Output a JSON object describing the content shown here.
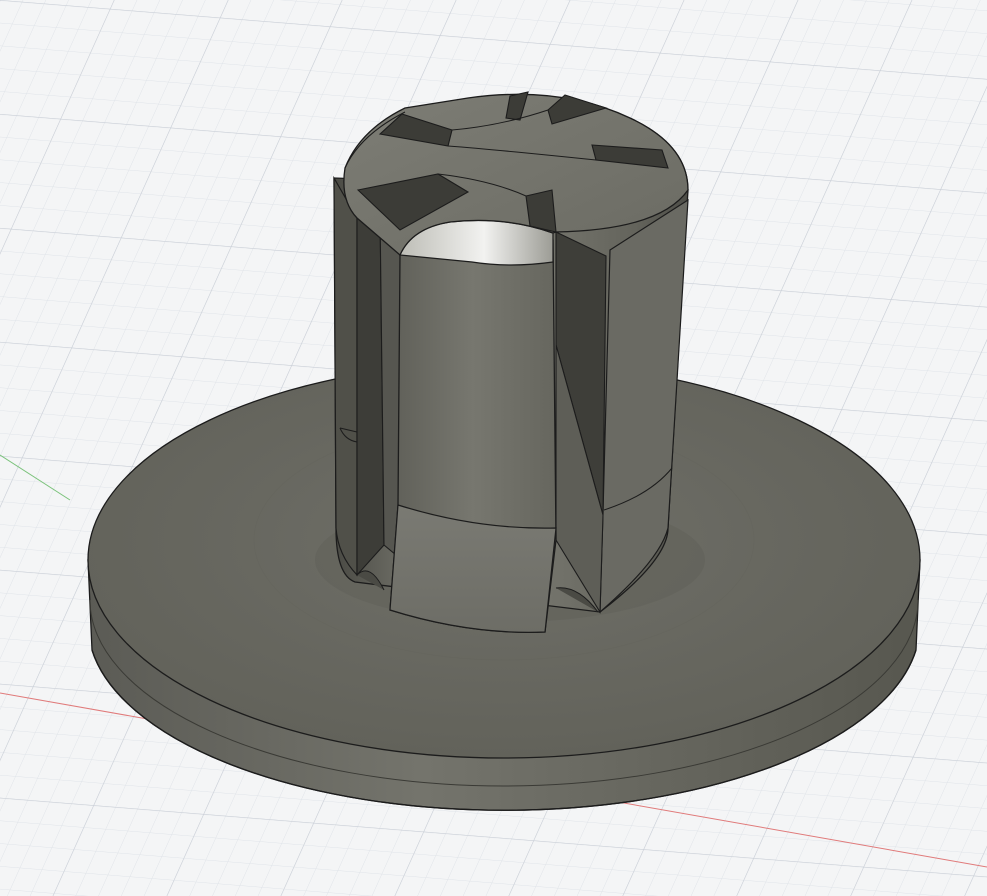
{
  "viewport": {
    "kind": "3D modeling canvas",
    "background_color": "#f4f5f6",
    "grid": {
      "visible": true,
      "minor_color": "#dfe3e8",
      "major_color": "#c9ced6"
    },
    "axes": {
      "x_axis_color": "#e07a7a",
      "y_axis_color": "#7ac27a"
    }
  },
  "model": {
    "name": "",
    "description_visible": false,
    "body_color": "#6e6e67",
    "highlight_color": "#f2f2f0",
    "edge_color": "#1c1c1c"
  }
}
